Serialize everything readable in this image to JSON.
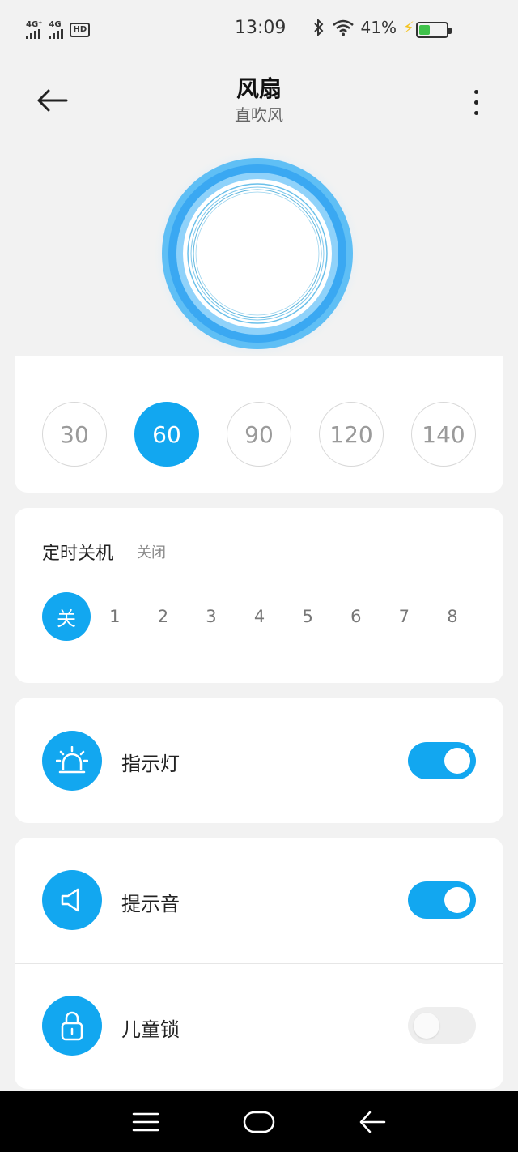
{
  "status_bar": {
    "sim1": "4G⁺",
    "sim2": "4G",
    "hd": "HD",
    "time": "13:09",
    "battery_percent": "41%",
    "battery_level": 0.41,
    "icons": [
      "signal-icon",
      "hd-icon",
      "bluetooth-icon",
      "wifi-icon",
      "charging-icon",
      "battery-icon"
    ]
  },
  "header": {
    "title": "风扇",
    "subtitle": "直吹风",
    "back_icon": "back-arrow-icon",
    "more_icon": "more-vertical-icon"
  },
  "speed": {
    "options": [
      "30",
      "60",
      "90",
      "120",
      "140"
    ],
    "selected": "60"
  },
  "timer": {
    "title": "定时关机",
    "status": "关闭",
    "options": [
      "关",
      "1",
      "2",
      "3",
      "4",
      "5",
      "6",
      "7",
      "8"
    ],
    "selected": "关"
  },
  "settings": {
    "indicator": {
      "label": "指示灯",
      "icon": "alarm-light-icon",
      "enabled": true
    },
    "sound": {
      "label": "提示音",
      "icon": "speaker-icon",
      "enabled": true
    },
    "child_lock": {
      "label": "儿童锁",
      "icon": "lock-icon",
      "enabled": false
    }
  },
  "colors": {
    "accent": "#12a7f0",
    "background": "#f2f2f2",
    "card": "#ffffff"
  },
  "navbar": {
    "icons": [
      "menu-icon",
      "home-icon",
      "back-icon"
    ]
  }
}
